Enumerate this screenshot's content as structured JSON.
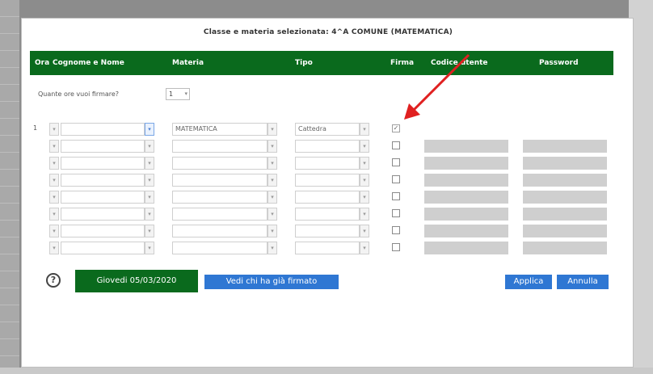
{
  "dialog": {
    "title": "Classe e materia selezionata: 4^A COMUNE (MATEMATICA)"
  },
  "header": {
    "col_ora": "Ora",
    "col_nome": "Cognome e Nome",
    "col_materia": "Materia",
    "col_tipo": "Tipo",
    "col_firma": "Firma",
    "col_codice": "Codice utente",
    "col_password": "Password",
    "corner_mark": "²"
  },
  "quante": {
    "label": "Quante ore vuoi firmare?",
    "value": "1",
    "arrow": "▾"
  },
  "rows": [
    {
      "num": "1",
      "materia": "MATEMATICA",
      "tipo": "Cattedra",
      "firma_checked": true
    },
    {
      "num": "",
      "materia": "",
      "tipo": "",
      "firma_checked": false
    },
    {
      "num": "",
      "materia": "",
      "tipo": "",
      "firma_checked": false
    },
    {
      "num": "",
      "materia": "",
      "tipo": "",
      "firma_checked": false
    },
    {
      "num": "",
      "materia": "",
      "tipo": "",
      "firma_checked": false
    },
    {
      "num": "",
      "materia": "",
      "tipo": "",
      "firma_checked": false
    },
    {
      "num": "",
      "materia": "",
      "tipo": "",
      "firma_checked": false
    },
    {
      "num": "",
      "materia": "",
      "tipo": "",
      "firma_checked": false
    }
  ],
  "footer": {
    "help_icon": "?",
    "date_button": "Giovedi 05/03/2020",
    "vedi_button": "Vedi chi ha già firmato",
    "applica_button": "Applica",
    "annulla_button": "Annulla"
  },
  "colors": {
    "header_green": "#0a6a1d",
    "button_blue": "#2f77d3",
    "arrow_red": "#e02020"
  }
}
